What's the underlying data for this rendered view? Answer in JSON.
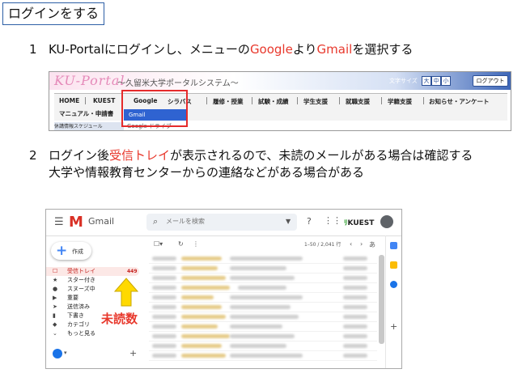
{
  "slide": {
    "title": "ログインをする",
    "step1": {
      "number": "1",
      "text_a": "KU-Portalにログインし、メニューの",
      "text_google": "Google",
      "text_b": "より",
      "text_gmail": "Gmail",
      "text_c": "を選択する"
    },
    "step2": {
      "number": "2",
      "line1_a": "ログイン後",
      "line1_red": "受信トレイ",
      "line1_b": "が表示されるので、未読のメールがある場合は確認する",
      "line2": "大学や情報教育センターからの連絡などがある場合がある"
    },
    "callout": "未読数"
  },
  "portal": {
    "logo": "KU-Portal",
    "subtitle": "～久留米大学ポータルシステム～",
    "font_size_label": "文字サイズ",
    "font_sizes": [
      "大",
      "中",
      "小"
    ],
    "logout": "ログアウト",
    "nav": [
      "HOME",
      "KUEST",
      "Google",
      "シラバス",
      "履修・授業",
      "試験・成績",
      "学生支援",
      "就職支援",
      "学籍支援",
      "お知らせ・アンケート"
    ],
    "nav_row2": "マニュアル・申請書",
    "dropdown": [
      "Gmail",
      "Google ドライブ"
    ],
    "left_block": "休講情報スケジュール"
  },
  "gmail": {
    "app_name": "Gmail",
    "search_placeholder": "メールを検索",
    "brand": "KUEST",
    "compose": "作成",
    "sidebar": [
      {
        "icon": "inbox-icon",
        "glyph": "☐",
        "label": "受信トレイ",
        "count": "449"
      },
      {
        "icon": "star-icon",
        "glyph": "★",
        "label": "スター付き"
      },
      {
        "icon": "snooze-icon",
        "glyph": "●",
        "label": "スヌーズ中"
      },
      {
        "icon": "important-icon",
        "glyph": "▶",
        "label": "重要"
      },
      {
        "icon": "sent-icon",
        "glyph": "➤",
        "label": "送信済み"
      },
      {
        "icon": "draft-icon",
        "glyph": "▮",
        "label": "下書き"
      },
      {
        "icon": "category-icon",
        "glyph": "◆",
        "label": "カテゴリ"
      },
      {
        "icon": "more-icon",
        "glyph": "⌄",
        "label": "もっと見る"
      }
    ],
    "pagination": "1–50 / 2,041 行",
    "sort_label": "あ"
  }
}
